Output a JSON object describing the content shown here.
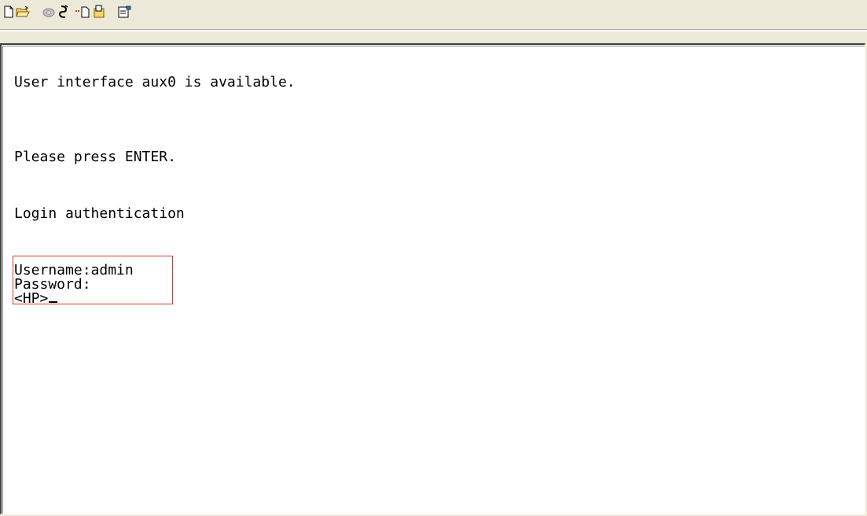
{
  "toolbar": {
    "buttons": [
      {
        "icon": "new-document-icon"
      },
      {
        "icon": "open-folder-icon"
      },
      {
        "icon": "connect-phone-icon"
      },
      {
        "icon": "disconnect-icon"
      },
      {
        "icon": "send-icon"
      },
      {
        "icon": "receive-icon"
      },
      {
        "icon": "properties-icon"
      }
    ]
  },
  "terminal": {
    "lines": [
      "User interface aux0 is available.",
      "Please press ENTER.",
      "Login authentication",
      "Username:admin",
      "Password:",
      "<HP>"
    ]
  },
  "highlight": {
    "color": "#e8332a"
  }
}
